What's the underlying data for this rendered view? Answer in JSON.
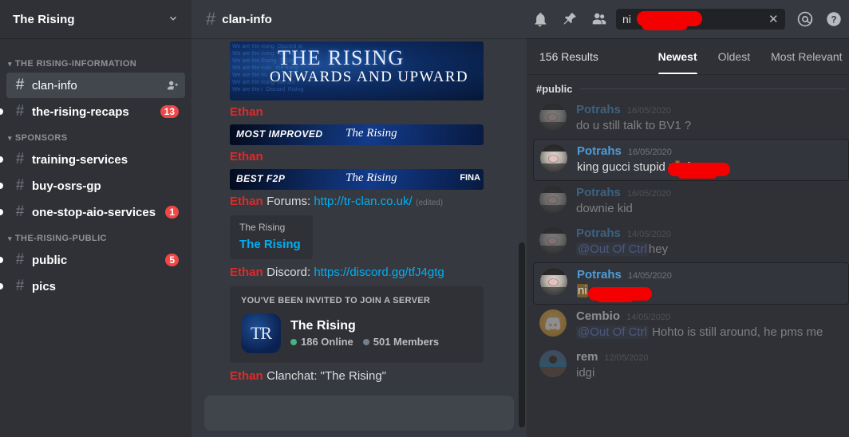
{
  "sidebar": {
    "server_name": "The Rising",
    "chevron_icon": "chevron-down-icon",
    "categories": [
      {
        "label": "The Rising-Information",
        "channels": [
          {
            "name": "clan-info",
            "badge": "",
            "active": true,
            "unread": false,
            "icon": "hash-icon",
            "action_icon": "add-member-icon"
          },
          {
            "name": "the-rising-recaps",
            "badge": "13",
            "active": false,
            "unread": true,
            "icon": "hash-icon"
          }
        ]
      },
      {
        "label": "Sponsors",
        "channels": [
          {
            "name": "training-services",
            "badge": "",
            "active": false,
            "unread": true,
            "icon": "hash-icon"
          },
          {
            "name": "buy-osrs-gp",
            "badge": "",
            "active": false,
            "unread": true,
            "icon": "hash-icon"
          },
          {
            "name": "one-stop-aio-services",
            "badge": "1",
            "active": false,
            "unread": true,
            "icon": "hash-icon"
          }
        ]
      },
      {
        "label": "The-Rising-Public",
        "channels": [
          {
            "name": "public",
            "badge": "5",
            "active": false,
            "unread": true,
            "icon": "hash-icon"
          },
          {
            "name": "pics",
            "badge": "",
            "active": false,
            "unread": true,
            "icon": "hash-icon-announcement"
          }
        ]
      }
    ]
  },
  "chat": {
    "channel_name": "clan-info",
    "hash_icon": "hash-icon",
    "messages": [
      {
        "type": "banner_big",
        "title": "The Rising",
        "subtitle": "Onwards and Upward",
        "noise": "We are the rising  Discord id\nWe are the rising   We are th\nWe are the Rising  Tr Disc\nWe are the risin   the rising\nWe are the ris   We are th\nWe are the rising  We are\nWe are the r  Discord  Rising"
      },
      {
        "type": "author",
        "name": "Ethan"
      },
      {
        "type": "banner_thin",
        "left": "MOST IMPROVED",
        "mid": "The Rising",
        "right": ""
      },
      {
        "type": "author",
        "name": "Ethan"
      },
      {
        "type": "banner_thin",
        "left": "BEST F2P",
        "mid": "The Rising",
        "right": "FINA"
      },
      {
        "type": "text",
        "name": "Ethan",
        "prefix": "Forums: ",
        "link": "http://tr-clan.co.uk/",
        "edited": "(edited)"
      },
      {
        "type": "embed",
        "provider": "The Rising",
        "title": "The Rising"
      },
      {
        "type": "text",
        "name": "Ethan",
        "prefix": "Discord: ",
        "link": "https://discord.gg/tfJ4gtg",
        "edited": ""
      },
      {
        "type": "invite",
        "header": "You've been invited to join a server",
        "icon_text": "TR",
        "server": "The Rising",
        "online": "186 Online",
        "members": "501 Members"
      },
      {
        "type": "text",
        "name": "Ethan",
        "prefix": "Clanchat: \"The Rising\"",
        "link": "",
        "edited": ""
      }
    ]
  },
  "search": {
    "input_value": "ni",
    "placeholder": "Search",
    "clear_icon": "close-icon",
    "header_icons": [
      "bell-icon",
      "pin-icon",
      "members-icon"
    ],
    "right_icons": [
      "mentions-icon",
      "help-icon"
    ],
    "results_count": "156 Results",
    "sorts": [
      {
        "label": "Newest",
        "active": true
      },
      {
        "label": "Oldest",
        "active": false
      },
      {
        "label": "Most Relevant",
        "active": false
      }
    ],
    "channel_label": "#public",
    "results": [
      {
        "avatar": "av-cat",
        "name": "Potrahs",
        "time": "16/05/2020",
        "text": "do u still talk to BV1 ?",
        "state": "ctx",
        "highlight": "",
        "mention": ""
      },
      {
        "avatar": "av-cat",
        "name": "Potrahs",
        "time": "16/05/2020",
        "text": "king gucci stupid n",
        "state": "hit",
        "highlight": "i",
        "suffix": "+fu",
        "redacted": true,
        "mention": ""
      },
      {
        "avatar": "av-cat",
        "name": "Potrahs",
        "time": "16/05/2020",
        "text": "downie kid",
        "state": "ctx",
        "highlight": "",
        "mention": ""
      },
      {
        "avatar": "av-cat",
        "name": "Potrahs",
        "time": "14/05/2020",
        "text": "hey ",
        "state": "ctx",
        "highlight": "",
        "mention": "@Out Of Ctrl"
      },
      {
        "avatar": "av-cat",
        "name": "Potrahs",
        "time": "14/05/2020",
        "text": "",
        "state": "hit",
        "highlight": "ni",
        "suffix": "",
        "redacted": true,
        "mention": ""
      },
      {
        "avatar": "av-discord",
        "name": "Cembio",
        "time": "14/05/2020",
        "text": " Hohto is still around, he pms me",
        "state": "ctx",
        "highlight": "",
        "mention": "@Out Of Ctrl"
      },
      {
        "avatar": "av-rem",
        "name": "rem",
        "time": "12/05/2020",
        "text": "idgi",
        "state": "ctx",
        "highlight": "",
        "mention": ""
      }
    ]
  },
  "colors": {
    "accent_blue": "#00aff4",
    "badge_red": "#f04747",
    "username_red": "#e02a2a",
    "online_green": "#43b581",
    "redaction_red": "#f50000",
    "sidebar_bg": "#2f3136",
    "chat_bg": "#36393f"
  }
}
